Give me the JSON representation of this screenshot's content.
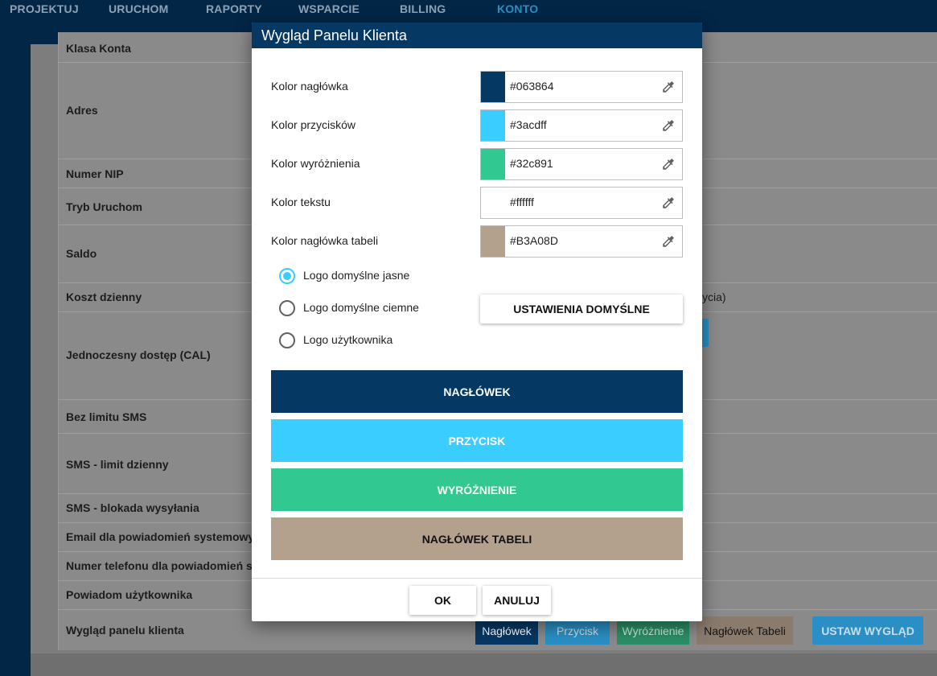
{
  "nav": {
    "items": [
      "PROJEKTUJ",
      "URUCHOM",
      "RAPORTY",
      "WSPARCIE",
      "BILLING",
      "KONTO"
    ],
    "active_index": 5
  },
  "account_rows": [
    "Klasa Konta",
    "Adres",
    "Numer NIP",
    "Tryb Uruchom",
    "Saldo",
    "Koszt dzienny",
    "Jednoczesny dostęp (CAL)",
    "Bez limitu SMS",
    "SMS - limit dzienny",
    "SMS - blokada wysyłania",
    "Email dla powiadomień systemowych",
    "Numer telefonu dla powiadomień sys",
    "Powiadom użytkownika",
    "Wygląd panelu klienta"
  ],
  "koszt_tail": "ycia)",
  "appearance_chips": {
    "header": "Nagłówek",
    "button": "Przycisk",
    "highlight": "Wyróżnienie",
    "table_header": "Nagłówek Tabeli"
  },
  "set_appearance_button": "USTAW WYGLĄD",
  "modal": {
    "title": "Wygląd Panelu Klienta",
    "colors": [
      {
        "label": "Kolor nagłówka",
        "value": "#063864",
        "swatch": "#063864"
      },
      {
        "label": "Kolor przycisków",
        "value": "#3acdff",
        "swatch": "#3acdff"
      },
      {
        "label": "Kolor wyróżnienia",
        "value": "#32c891",
        "swatch": "#32c891"
      },
      {
        "label": "Kolor tekstu",
        "value": "#ffffff",
        "swatch": "#ffffff"
      },
      {
        "label": "Kolor nagłówka tabeli",
        "value": "#B3A08D",
        "swatch": "#B3A08D"
      }
    ],
    "logo_options": [
      {
        "label": "Logo domyślne jasne",
        "checked": true
      },
      {
        "label": "Logo domyślne ciemne",
        "checked": false
      },
      {
        "label": "Logo użytkownika",
        "checked": false
      }
    ],
    "defaults_button": "USTAWIENIA DOMYŚLNE",
    "preview": {
      "header": "NAGŁÓWEK",
      "button": "PRZYCISK",
      "highlight": "WYRÓŻNIENIE",
      "table_header": "NAGŁÓWEK TABELI"
    },
    "ok_button": "OK",
    "cancel_button": "ANULUJ"
  },
  "icons": {
    "picker": "eyedropper-icon"
  },
  "colors": {
    "nav_bg": "#022646",
    "accent": "#3acdff"
  }
}
